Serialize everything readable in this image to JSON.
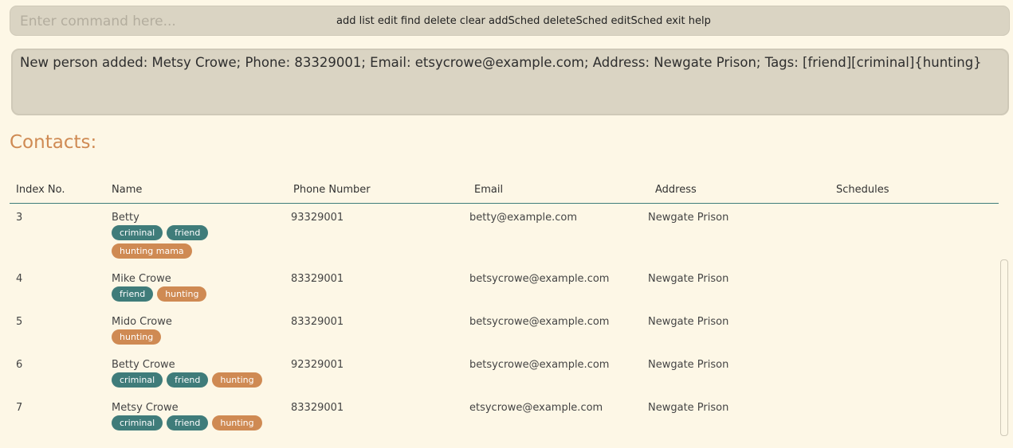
{
  "command": {
    "placeholder": "Enter command here...",
    "value": "",
    "hints": "add list edit find delete clear addSched deleteSched editSched exit help"
  },
  "result": {
    "text": "New person added: Metsy Crowe; Phone: 83329001; Email: etsycrowe@example.com; Address: Newgate Prison; Tags: [friend][criminal]{hunting}"
  },
  "contacts": {
    "title": "Contacts:",
    "columns": [
      "Index No.",
      "Name",
      "Phone Number",
      "Email",
      "Address",
      "Schedules"
    ],
    "rows": [
      {
        "index": "3",
        "name": "Betty",
        "phone": "93329001",
        "email": "betty@example.com",
        "address": "Newgate Prison",
        "schedules": "",
        "tags": [
          {
            "label": "criminal",
            "color": "teal"
          },
          {
            "label": "friend",
            "color": "teal"
          },
          {
            "label": "hunting mama",
            "color": "orange"
          }
        ]
      },
      {
        "index": "4",
        "name": "Mike Crowe",
        "phone": "83329001",
        "email": "betsycrowe@example.com",
        "address": "Newgate Prison",
        "schedules": "",
        "tags": [
          {
            "label": "friend",
            "color": "teal"
          },
          {
            "label": "hunting",
            "color": "orange"
          }
        ]
      },
      {
        "index": "5",
        "name": "Mido Crowe",
        "phone": "83329001",
        "email": "betsycrowe@example.com",
        "address": "Newgate Prison",
        "schedules": "",
        "tags": [
          {
            "label": "hunting",
            "color": "orange"
          }
        ]
      },
      {
        "index": "6",
        "name": "Betty Crowe",
        "phone": "92329001",
        "email": "betsycrowe@example.com",
        "address": "Newgate Prison",
        "schedules": "",
        "tags": [
          {
            "label": "criminal",
            "color": "teal"
          },
          {
            "label": "friend",
            "color": "teal"
          },
          {
            "label": "hunting",
            "color": "orange"
          }
        ]
      },
      {
        "index": "7",
        "name": "Metsy Crowe",
        "phone": "83329001",
        "email": "etsycrowe@example.com",
        "address": "Newgate Prison",
        "schedules": "",
        "tags": [
          {
            "label": "criminal",
            "color": "teal"
          },
          {
            "label": "friend",
            "color": "teal"
          },
          {
            "label": "hunting",
            "color": "orange"
          }
        ]
      }
    ]
  },
  "colors": {
    "background": "#fdf7e6",
    "panel": "#dad4c3",
    "accent_orange": "#cf8a53",
    "accent_teal": "#3f7c7a"
  }
}
